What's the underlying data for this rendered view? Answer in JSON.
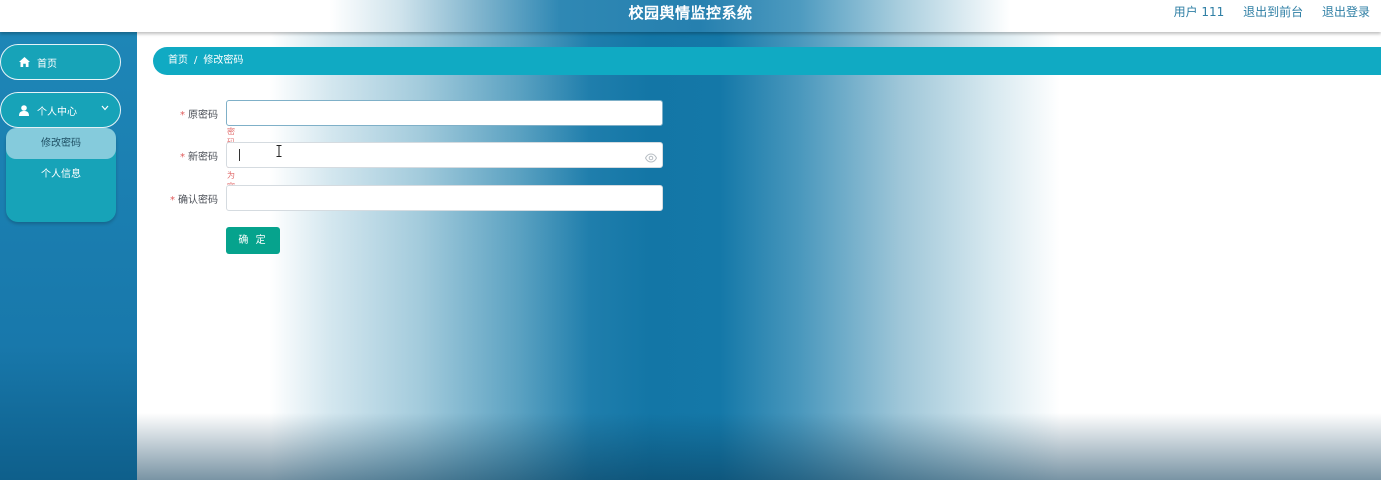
{
  "header": {
    "title": "校园舆情监控系统",
    "user_label": "用户 111",
    "to_front_label": "退出到前台",
    "logout_label": "退出登录"
  },
  "sidebar": {
    "home_label": "首页",
    "personal_center_label": "个人中心",
    "submenu": [
      {
        "label": "修改密码",
        "active": true
      },
      {
        "label": "个人信息",
        "active": false
      }
    ]
  },
  "breadcrumb": {
    "home": "首页",
    "separator": "/",
    "current": "修改密码"
  },
  "form": {
    "old_password": {
      "label": "原密码",
      "value": "",
      "error": "密码不能为空"
    },
    "new_password": {
      "label": "新密码",
      "value": ""
    },
    "confirm_password": {
      "label": "确认密码",
      "value": ""
    },
    "submit_label": "确 定"
  },
  "icons": {
    "home": "home-icon",
    "user": "user-icon",
    "chevron": "chevron-down-icon",
    "eye": "eye-icon"
  },
  "colors": {
    "accent": "#10aac3",
    "button": "#06a38d",
    "error": "#e06a6a",
    "required_star": "#e05c5c"
  }
}
